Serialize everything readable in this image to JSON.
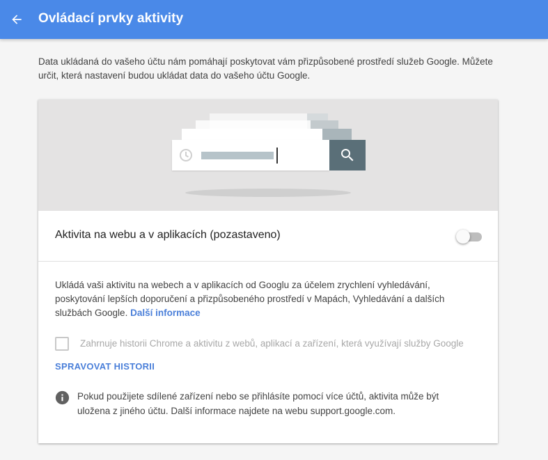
{
  "header": {
    "title": "Ovládací prvky aktivity",
    "back_icon": "arrow-back-icon",
    "background_color": "#4a89e8"
  },
  "intro": {
    "text": "Data ukládaná do vašeho účtu nám pomáhají poskytovat vám přizpůsobené prostředí služeb Google. Můžete určit, která nastavení budou ukládat data do vašeho účtu Google."
  },
  "card": {
    "illustration_icons": [
      "clock-icon",
      "search-icon"
    ],
    "toggle": {
      "label": "Aktivita na webu a v aplikacích (pozastaveno)",
      "enabled": false
    },
    "description": {
      "text": "Ukládá vaši aktivitu na webech a v aplikacích od Googlu za účelem zrychlení vyhledávání, poskytování lepších doporučení a přizpůsobeného prostředí v Mapách, Vyhledávání a dalších službách Google.",
      "link": "Další informace"
    },
    "chrome_history": {
      "label": "Zahrnuje historii Chrome a aktivitu z webů, aplikací a zařízení, která využívají služby Google",
      "checked": false,
      "disabled": true
    },
    "manage_history_label": "SPRAVOVAT HISTORII",
    "note": {
      "icon": "info-icon",
      "text": "Pokud použijete sdílené zařízení nebo se přihlásíte pomocí více účtů, aktivita může být uložena z jiného účtu. Další informace najdete na webu support.google.com."
    }
  },
  "colors": {
    "accent": "#4a89e8",
    "link": "#4a7fd9",
    "search_button": "#5a6f78"
  }
}
